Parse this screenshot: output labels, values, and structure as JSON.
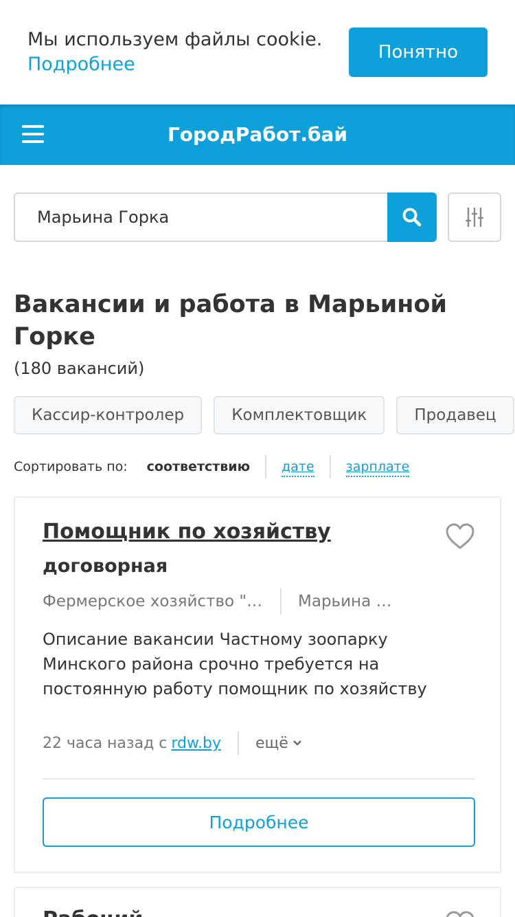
{
  "cookie": {
    "text": "Мы используем файлы cookie.",
    "link": "Подробнее",
    "button": "Понятно"
  },
  "header": {
    "logo": "ГородРабот.бай",
    "menu_icon": "hamburger-menu-icon"
  },
  "search": {
    "value": "Марьина Горка",
    "search_icon": "search-icon",
    "filter_icon": "filter-sliders-icon"
  },
  "page": {
    "title": "Вакансии и работа в Марьиной Горке",
    "count": "(180 вакансий)"
  },
  "chips": [
    "Кассир-контролер",
    "Комплектовщик",
    "Продавец"
  ],
  "sort": {
    "label": "Сортировать по:",
    "options": [
      "соответствию",
      "дате",
      "зарплате"
    ],
    "active": "соответствию"
  },
  "vacancy": {
    "title": "Помощник по хозяйству",
    "salary": "договорная",
    "company": "Фермерское хозяйство \"ВОЛЬНАЯ ДОЛИНА\"",
    "city": "Марьина Горка",
    "description": "Описание вакансии Частному зоопарку Минского района срочно требуется на постоянную работу помощник по хозяйству",
    "time": "22 часа назад с",
    "source": "rdw.by",
    "more": "ещё",
    "button": "Подробнее",
    "favorite_icon": "heart-icon"
  },
  "next_vacancy": {
    "title": "Рабочий"
  },
  "colors": {
    "accent": "#0ea0db",
    "text": "#333333",
    "muted": "#777777"
  }
}
